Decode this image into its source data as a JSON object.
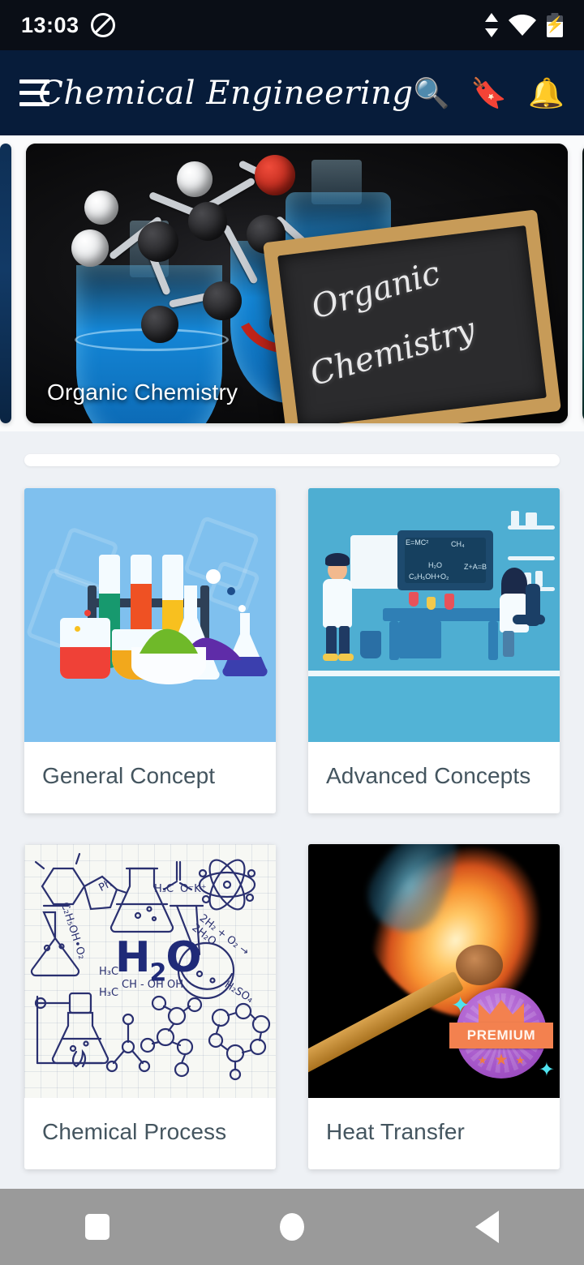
{
  "status_bar": {
    "time": "13:03",
    "dnd_icon": "do-not-disturb-icon",
    "data_icon": "data-transfer-icon",
    "wifi_icon": "wifi-icon",
    "battery_icon": "battery-charging-icon"
  },
  "app_bar": {
    "menu_icon": "hamburger-menu-icon",
    "title": "Chemical Engineering",
    "actions": [
      {
        "icon": "search-icon",
        "glyph": "🔍"
      },
      {
        "icon": "bookmark-icon",
        "glyph": "🔖"
      },
      {
        "icon": "notification-bell-icon",
        "glyph": "🔔"
      }
    ]
  },
  "carousel": {
    "current_slide_caption": "Organic Chemistry",
    "chalkboard_line1": "Organic",
    "chalkboard_line2": "Chemistry",
    "peek_left_color": "#123a66",
    "peek_right_color": "#0f4a48"
  },
  "divider_bar": {
    "name": "empty-white-strip"
  },
  "grid": {
    "cards": [
      {
        "label": "General Concept",
        "art": "lab-glassware-illustration",
        "bg": "#7fc0ee",
        "premium": false
      },
      {
        "label": "Advanced Concepts",
        "art": "laboratory-scientists-illustration",
        "bg": "#4eaed2",
        "premium": false
      },
      {
        "label": "Chemical Process",
        "art": "chemistry-doodles-illustration",
        "bg": "#f7f8f4",
        "premium": false
      },
      {
        "label": "Heat Transfer",
        "art": "burning-match-photo",
        "bg": "#000000",
        "premium": true
      }
    ],
    "premium_badge_text": "PREMIUM"
  },
  "doodles": {
    "h2o": "H",
    "h2o_sub": "2",
    "h2o_end": "O",
    "labels": [
      "Ph",
      "H₃C",
      "O⁻K⁺",
      "C₂H₅OH∙O₂",
      "2H₂ + O₂ → 2H₂O",
      "H₂SO₄",
      "H₃C",
      "CH - OH",
      "OH",
      "H₃C"
    ]
  },
  "nav_bar": {
    "buttons": [
      {
        "icon": "recents-square-icon"
      },
      {
        "icon": "home-circle-icon"
      },
      {
        "icon": "back-triangle-icon"
      }
    ]
  }
}
